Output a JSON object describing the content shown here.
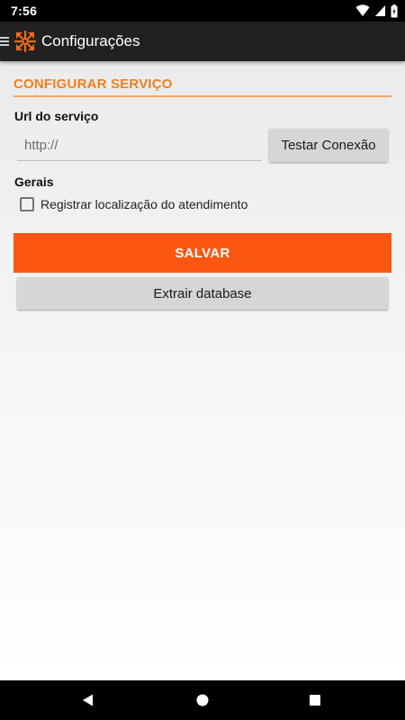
{
  "status_bar": {
    "time": "7:56",
    "icons": [
      "wifi-icon",
      "cellular-icon",
      "battery-icon"
    ]
  },
  "app_bar": {
    "title": "Configurações",
    "icons": [
      "menu-icon",
      "app-logo-icon"
    ]
  },
  "section": {
    "title": "CONFIGURAR SERVIÇO"
  },
  "service": {
    "url_label": "Url do serviço",
    "url_value": "",
    "url_placeholder": "http://",
    "test_button": "Testar Conexão"
  },
  "general": {
    "label": "Gerais",
    "checkbox_label": "Registrar localização do atendimento",
    "checkbox_checked": false
  },
  "actions": {
    "save_label": "SALVAR",
    "extract_label": "Extrair database"
  },
  "nav_bar": {
    "icons": [
      "back-icon",
      "home-icon",
      "recents-icon"
    ]
  },
  "colors": {
    "accent": "#f07f1c",
    "save_button": "#fb5612",
    "app_bar": "#212121",
    "secondary_button": "#d6d6d6"
  }
}
